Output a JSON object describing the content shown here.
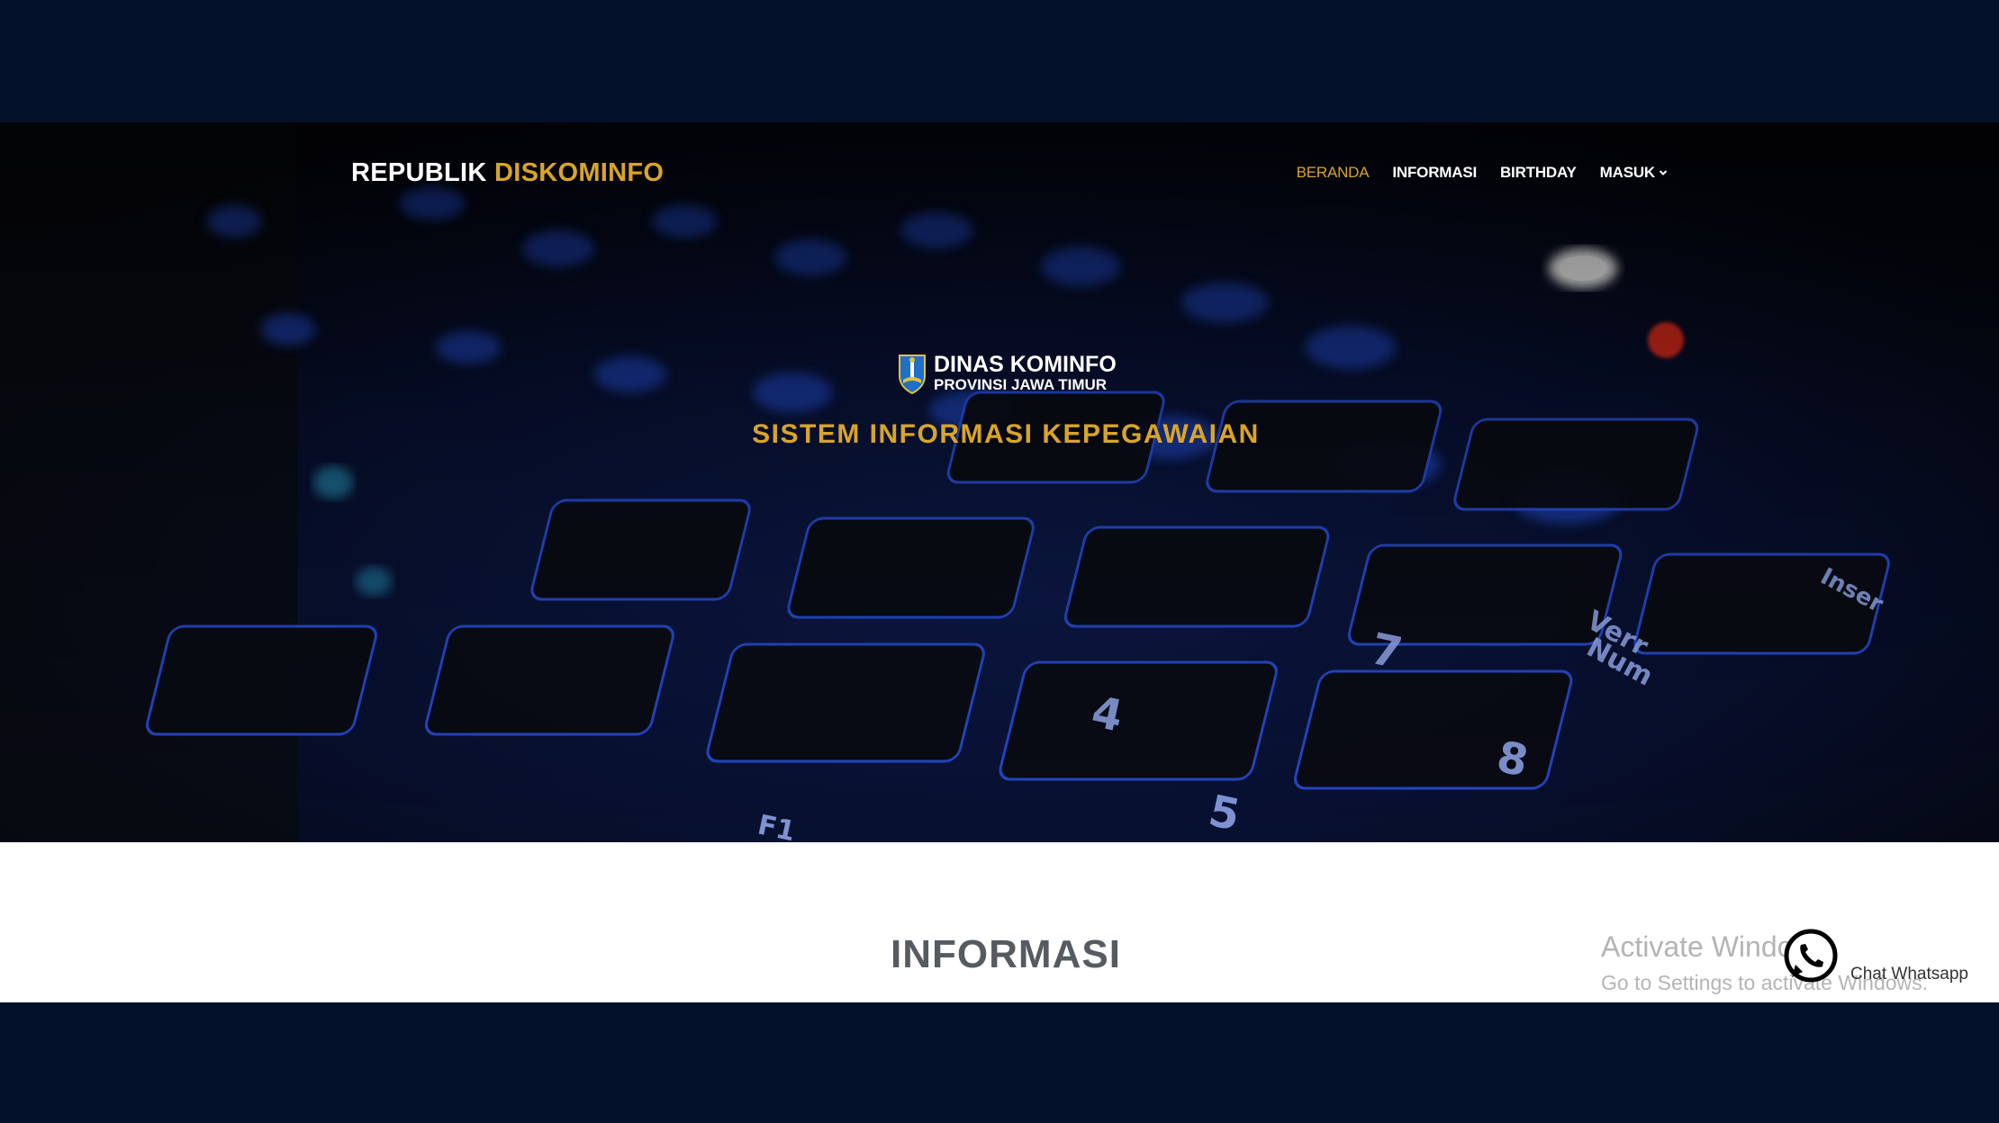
{
  "navbar": {
    "brand_part1": "REPUBLIK",
    "brand_part2": "DISKOMINFO",
    "items": [
      {
        "label": "BERANDA",
        "active": true
      },
      {
        "label": "INFORMASI",
        "active": false
      },
      {
        "label": "BIRTHDAY",
        "active": false
      },
      {
        "label": "MASUK",
        "active": false,
        "dropdown": true
      }
    ]
  },
  "hero": {
    "logo_line1": "DINAS KOMINFO",
    "logo_line2": "PROVINSI JAWA TIMUR",
    "subtitle": "SISTEM INFORMASI KEPEGAWAIAN"
  },
  "section": {
    "title": "INFORMASI"
  },
  "watermark": {
    "line1": "Activate Windows",
    "line2": "Go to Settings to activate Windows."
  },
  "whatsapp": {
    "label": "Chat Whatsapp"
  },
  "colors": {
    "accent": "#d9a528",
    "frame": "#04112b",
    "section_title": "#555b61",
    "whatsapp": "#000000"
  }
}
